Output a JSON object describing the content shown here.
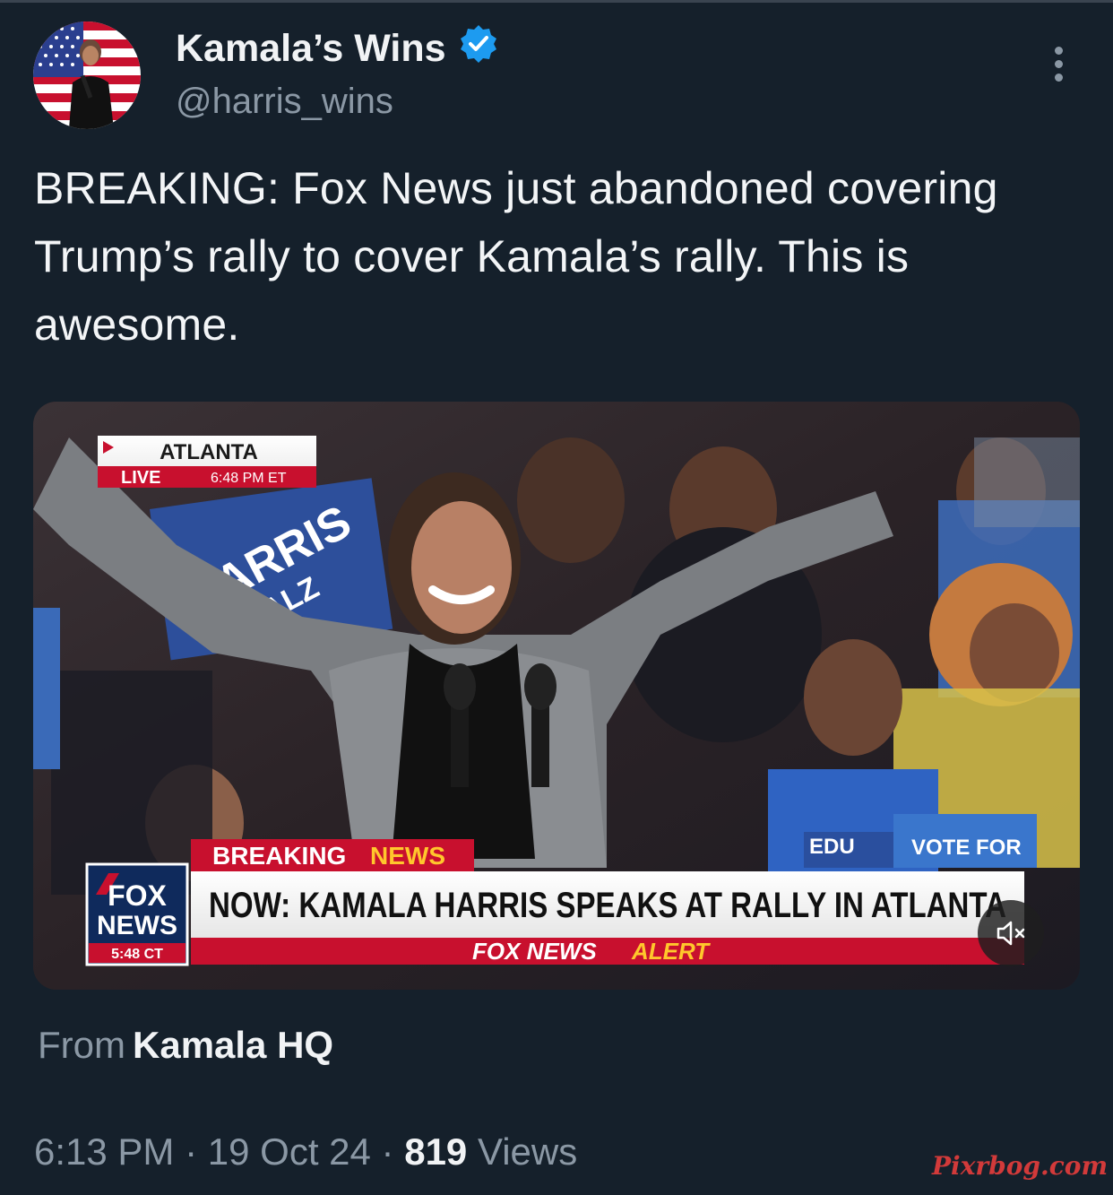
{
  "author": {
    "display_name": "Kamala’s Wins",
    "handle": "@harris_wins",
    "verified_icon": "verified-badge-icon"
  },
  "more_icon": "more-vertical-icon",
  "tweet": {
    "text": "BREAKING: Fox News just abandoned covering Trump’s rally to cover Kamala’s rally. This is awesome."
  },
  "media": {
    "location_label": "ATLANTA",
    "live_label": "LIVE",
    "live_time": "6:48 PM ET",
    "sign_line1": "HARRIS",
    "sign_line2": "WALZ",
    "breaking_label_1": "BREAKING",
    "breaking_label_2": "NEWS",
    "headline": "NOW: KAMALA HARRIS SPEAKS AT RALLY IN ATLANTA",
    "logo_line1": "FOX",
    "logo_line2": "NEWS",
    "logo_time": "5:48 CT",
    "alert_label_1": "FOX NEWS",
    "alert_label_2": "ALERT",
    "background_sign_1": "EDU",
    "background_sign_2": "VOTE FOR",
    "mute_icon": "muted-speaker-icon"
  },
  "source": {
    "prefix": "From",
    "name": "Kamala HQ"
  },
  "meta": {
    "time": "6:13 PM",
    "separator": "·",
    "date": "19 Oct 24",
    "views_count": "819",
    "views_label": "Views"
  },
  "watermark": "Pixrbog.com",
  "colors": {
    "background": "#15202b",
    "secondary_text": "#8b98a5",
    "verified_blue": "#1d9bf0",
    "fox_red": "#c8102e",
    "fox_navy": "#0f2a5c",
    "fox_yellow": "#ffc72c"
  }
}
